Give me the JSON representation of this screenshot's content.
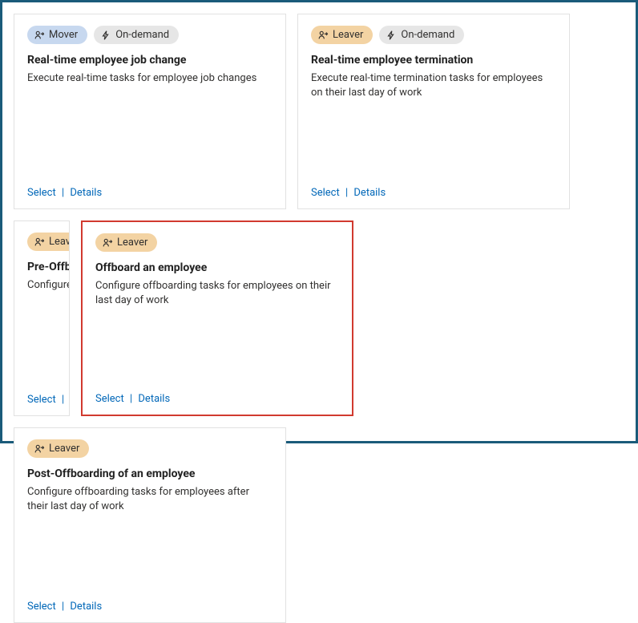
{
  "tags": {
    "mover": "Mover",
    "leaver": "Leaver",
    "ondemand": "On-demand"
  },
  "actions": {
    "select": "Select",
    "details": "Details"
  },
  "cards": [
    {
      "title": "Real-time employee job change",
      "desc": "Execute real-time tasks for employee job changes"
    },
    {
      "title": "Real-time employee termination",
      "desc": "Execute real-time termination tasks for employees on their last day of work"
    },
    {
      "title": "Pre-Offboard",
      "desc": "Configure pre before their la"
    },
    {
      "title": "Offboard an employee",
      "desc": "Configure offboarding tasks for employees on their last day of work"
    },
    {
      "title": "Post-Offboarding of an employee",
      "desc": "Configure offboarding tasks for employees after their last day of work"
    }
  ]
}
